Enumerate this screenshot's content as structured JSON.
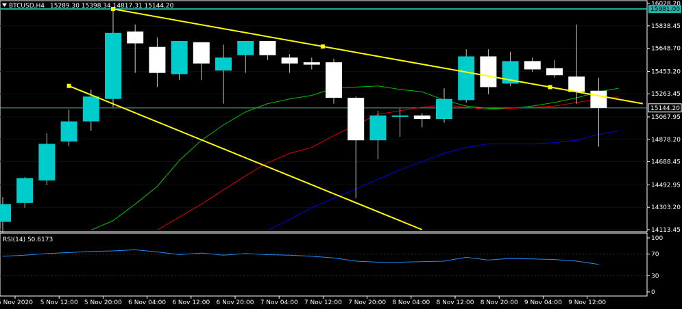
{
  "header": {
    "symbol_label": "BTCUSD,H4",
    "ohlc_text": "15289.30 15398.34 14817.31 15144.20",
    "rsi_label": "RSI(14) 50.6173"
  },
  "colors": {
    "background": "#000000",
    "frame": "#ffffff",
    "bull_candle": "#00cccc",
    "bear_candle": "#ffffff",
    "trendline": "#ffff00",
    "ma_fast": "#00c000",
    "ma_mid": "#dd0000",
    "ma_slow": "#0000dd",
    "rsi_line": "#1e90ff",
    "horizontal_level": "#20b2aa",
    "current_price_line": "#5f9ea0"
  },
  "chart_data": {
    "type": "candlestick",
    "symbol": "BTCUSD",
    "timeframe": "H4",
    "ylim": [
      14113.45,
      16028.2
    ],
    "y_ticks": [
      "16028.20",
      "15838.45",
      "15648.70",
      "15453.20",
      "15263.45",
      "15067.95",
      "14878.20",
      "14688.45",
      "14492.95",
      "14303.20",
      "14113.45"
    ],
    "x_tick_labels": [
      "5 Nov 2020",
      "5 Nov 12:00",
      "5 Nov 20:00",
      "6 Nov 04:00",
      "6 Nov 12:00",
      "6 Nov 20:00",
      "7 Nov 04:00",
      "7 Nov 12:00",
      "7 Nov 20:00",
      "8 Nov 04:00",
      "8 Nov 12:00",
      "8 Nov 20:00",
      "9 Nov 04:00",
      "9 Nov 12:00"
    ],
    "price_labels": {
      "level": "15981.00",
      "current": "15144.20"
    },
    "level_price": 15981.0,
    "current_price": 15144.2,
    "candles": [
      {
        "o": 14180,
        "h": 14390,
        "l": 14080,
        "c": 14330
      },
      {
        "o": 14340,
        "h": 14560,
        "l": 14300,
        "c": 14550
      },
      {
        "o": 14530,
        "h": 14930,
        "l": 14490,
        "c": 14840
      },
      {
        "o": 14860,
        "h": 15130,
        "l": 14820,
        "c": 15030
      },
      {
        "o": 15030,
        "h": 15300,
        "l": 14950,
        "c": 15240
      },
      {
        "o": 15220,
        "h": 15980,
        "l": 15150,
        "c": 15780
      },
      {
        "o": 15790,
        "h": 15850,
        "l": 15440,
        "c": 15690
      },
      {
        "o": 15660,
        "h": 15740,
        "l": 15320,
        "c": 15440
      },
      {
        "o": 15430,
        "h": 15690,
        "l": 15380,
        "c": 15710
      },
      {
        "o": 15700,
        "h": 15700,
        "l": 15380,
        "c": 15520
      },
      {
        "o": 15460,
        "h": 15680,
        "l": 15180,
        "c": 15570
      },
      {
        "o": 15590,
        "h": 15690,
        "l": 15440,
        "c": 15710
      },
      {
        "o": 15710,
        "h": 15710,
        "l": 15550,
        "c": 15590
      },
      {
        "o": 15570,
        "h": 15600,
        "l": 15440,
        "c": 15520
      },
      {
        "o": 15530,
        "h": 15570,
        "l": 15470,
        "c": 15510
      },
      {
        "o": 15530,
        "h": 15560,
        "l": 15180,
        "c": 15230
      },
      {
        "o": 15230,
        "h": 15240,
        "l": 14380,
        "c": 14870
      },
      {
        "o": 14870,
        "h": 15120,
        "l": 14710,
        "c": 15080
      },
      {
        "o": 15070,
        "h": 15140,
        "l": 14900,
        "c": 15080
      },
      {
        "o": 15080,
        "h": 15100,
        "l": 14980,
        "c": 15050
      },
      {
        "o": 15050,
        "h": 15310,
        "l": 15020,
        "c": 15220
      },
      {
        "o": 15210,
        "h": 15640,
        "l": 15190,
        "c": 15580
      },
      {
        "o": 15580,
        "h": 15640,
        "l": 15260,
        "c": 15320
      },
      {
        "o": 15350,
        "h": 15620,
        "l": 15330,
        "c": 15540
      },
      {
        "o": 15540,
        "h": 15570,
        "l": 15450,
        "c": 15470
      },
      {
        "o": 15480,
        "h": 15550,
        "l": 15400,
        "c": 15420
      },
      {
        "o": 15410,
        "h": 15850,
        "l": 15180,
        "c": 15280
      },
      {
        "o": 15289.3,
        "h": 15398.34,
        "l": 14817.31,
        "c": 15144.2
      }
    ],
    "ma_fast": [
      null,
      null,
      null,
      null,
      14110,
      14190,
      14330,
      14480,
      14700,
      14870,
      15000,
      15110,
      15180,
      15220,
      15250,
      15310,
      15320,
      15330,
      15300,
      15280,
      15210,
      15160,
      15140,
      15140,
      15160,
      15190,
      15230,
      15280
    ],
    "ma_mid": [
      null,
      null,
      null,
      null,
      null,
      null,
      null,
      14110,
      14220,
      14330,
      14450,
      14570,
      14680,
      14760,
      14810,
      14910,
      15000,
      15090,
      15120,
      15150,
      15170,
      15150,
      15130,
      15140,
      15150,
      15160,
      15190,
      15220
    ],
    "ma_slow": [
      null,
      null,
      null,
      null,
      null,
      null,
      null,
      null,
      null,
      null,
      null,
      null,
      14110,
      14200,
      14300,
      14380,
      14460,
      14540,
      14620,
      14690,
      14760,
      14810,
      14840,
      14840,
      14840,
      14850,
      14870,
      14920
    ],
    "trendlines": [
      {
        "x0": 5,
        "y0": 15981,
        "x1": 29,
        "y1": 15180
      },
      {
        "x0": 3,
        "y0": 15330,
        "x1": 19,
        "y1": 14113.45
      }
    ],
    "rsi": {
      "ylim": [
        0,
        100
      ],
      "ticks": [
        "100",
        "70",
        "30",
        "0"
      ],
      "values": [
        66,
        68,
        71,
        73,
        75,
        76,
        78,
        74,
        69,
        72,
        68,
        71,
        69,
        68,
        66,
        63,
        57,
        55,
        55,
        56,
        57,
        64,
        59,
        62,
        61,
        60,
        57,
        51
      ]
    }
  }
}
